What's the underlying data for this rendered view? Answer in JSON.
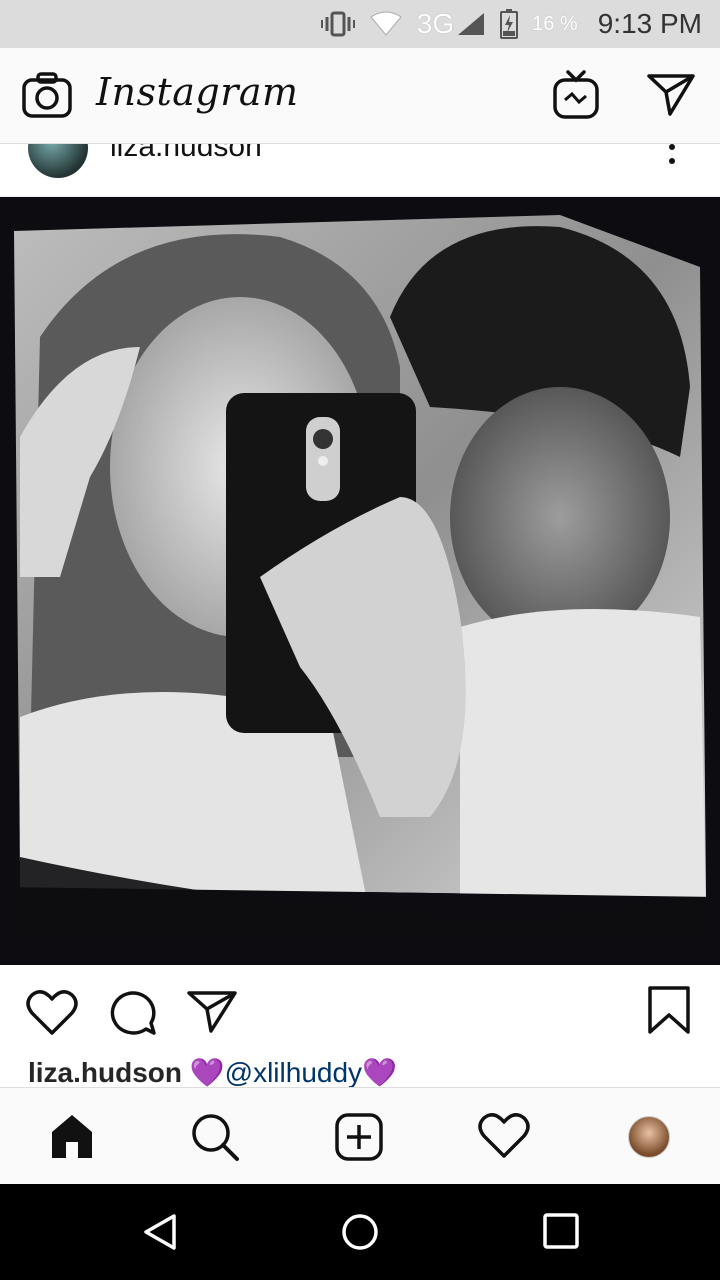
{
  "status_bar": {
    "network": "3G",
    "battery": "16 %",
    "time": "9:13 PM",
    "icons": [
      "vibrate-icon",
      "signal-wifi-icon",
      "cell-signal-icon",
      "battery-charging-icon"
    ]
  },
  "header": {
    "app_name": "Instagram",
    "icons": [
      "camera-icon",
      "igtv-icon",
      "direct-message-icon"
    ]
  },
  "post": {
    "username": "liza.hudson",
    "caption": {
      "username": "liza.hudson",
      "heart1": "💜",
      "mention": "@xlilhuddy",
      "heart2": "💜"
    },
    "actions": [
      "like-icon",
      "comment-icon",
      "share-icon",
      "bookmark-icon"
    ]
  },
  "bottom_nav": {
    "items": [
      "home-icon",
      "search-icon",
      "new-post-icon",
      "activity-icon",
      "profile-avatar"
    ]
  },
  "system_nav": {
    "items": [
      "back-icon",
      "home-circle-icon",
      "recents-icon"
    ]
  }
}
